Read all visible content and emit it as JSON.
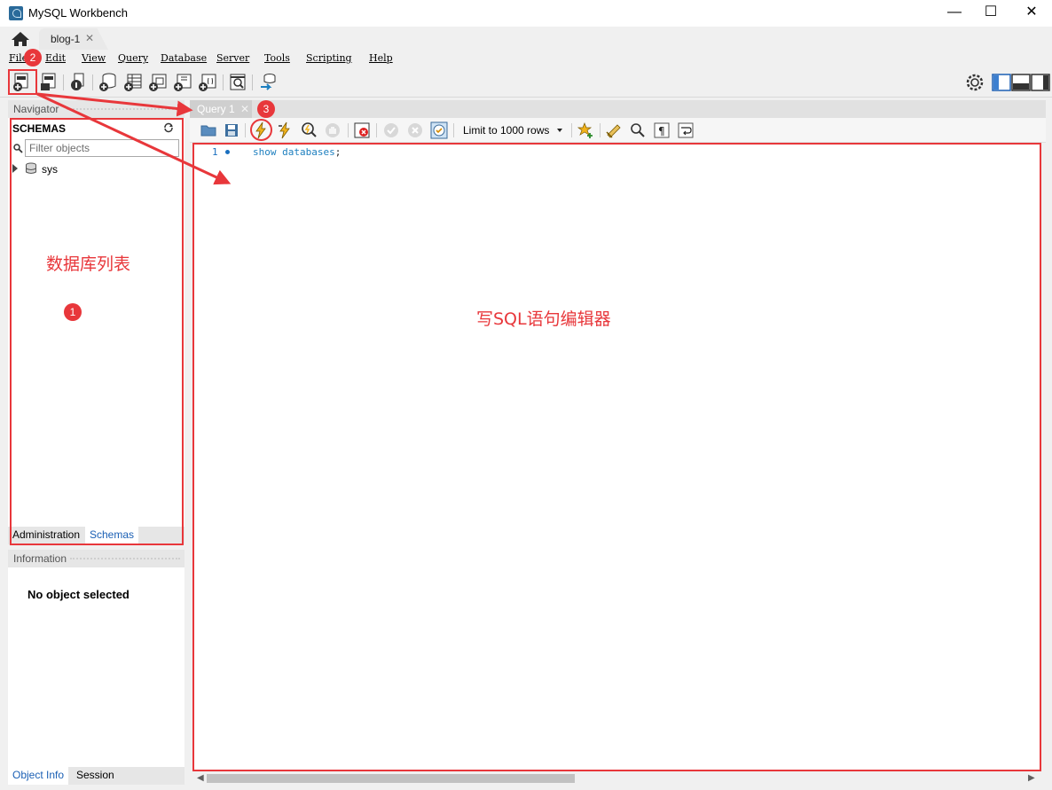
{
  "window": {
    "title": "MySQL Workbench",
    "controls": {
      "minimize": "—",
      "maximize": "☐",
      "close": "✕"
    }
  },
  "connection_tab": {
    "label": "blog-1",
    "close": "✕"
  },
  "menu": [
    "File",
    "Edit",
    "View",
    "Query",
    "Database",
    "Server",
    "Tools",
    "Scripting",
    "Help"
  ],
  "navigator": {
    "header": "Navigator",
    "schemas_title": "SCHEMAS",
    "filter_placeholder": "Filter objects",
    "tree": [
      {
        "label": "sys"
      }
    ],
    "tabs": [
      "Administration",
      "Schemas"
    ],
    "active_tab": "Schemas"
  },
  "information": {
    "header": "Information",
    "message": "No object selected",
    "tabs": [
      "Object Info",
      "Session"
    ],
    "active_tab": "Object Info"
  },
  "query": {
    "tab_label": "Query 1",
    "tab_close": "✕",
    "limit_select": "Limit to 1000 rows",
    "lines": [
      {
        "number": "1",
        "text": "show databases",
        "terminator": ";"
      }
    ]
  },
  "annotations": {
    "badge_1": "1",
    "badge_2": "2",
    "badge_3": "3",
    "label_schema_list": "数据库列表",
    "label_sql_editor": "写SQL语句编辑器",
    "color": "#e8373b"
  },
  "colors": {
    "accent_blue": "#1d7fbf",
    "annotation_red": "#e8373b"
  }
}
